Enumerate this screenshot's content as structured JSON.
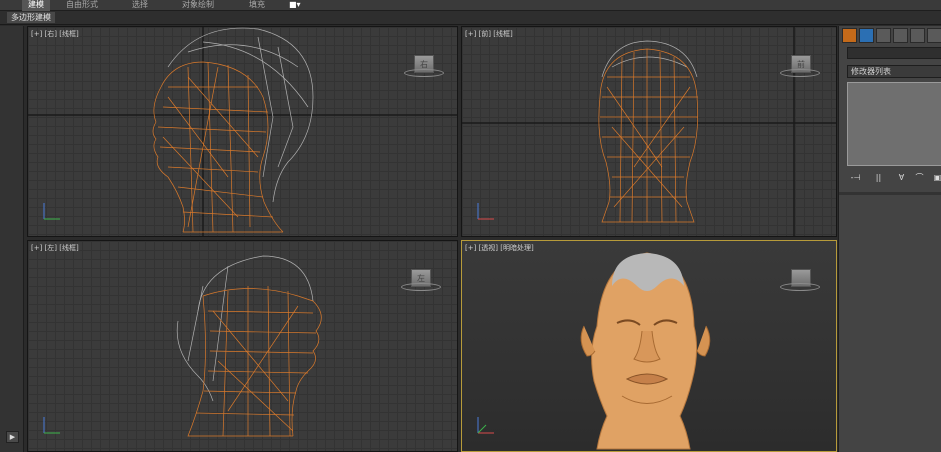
{
  "ribbon": {
    "tabs": [
      {
        "label": "建模",
        "active": true
      },
      {
        "label": "自由形式",
        "active": false
      },
      {
        "label": "选择",
        "active": false
      },
      {
        "label": "对象绘制",
        "active": false
      },
      {
        "label": "填充",
        "active": false
      }
    ],
    "extra_icon": "dropdown-icon",
    "sub_label": "多边形建模"
  },
  "viewports": {
    "top_left": {
      "label": "[+] [右] [线框]",
      "cube_face": "右"
    },
    "top_right": {
      "label": "[+] [前] [线框]",
      "cube_face": "前"
    },
    "bottom_left": {
      "label": "[+] [左] [线框]",
      "cube_face": "左"
    },
    "bottom_right": {
      "label": "[+] [透视] [明暗处理]",
      "cube_face": ""
    }
  },
  "command_panel": {
    "tab_icons": [
      "create-icon",
      "modify-icon",
      "hierarchy-icon",
      "motion-icon",
      "display-icon",
      "utilities-icon"
    ],
    "modifier_list_label": "修改器列表",
    "stack_tool_icons": [
      "pin-stack-icon",
      "show-end-result-icon",
      "make-unique-icon",
      "remove-modifier-icon",
      "configure-sets-icon"
    ]
  },
  "colors": {
    "wire_orange": "#d9792b",
    "wire_gray": "#b0b0b0",
    "skin": "#e0a264",
    "hair": "#b8b8b8",
    "active_border": "#b79b3a"
  },
  "timeline": {
    "play_icon": "play-icon"
  }
}
